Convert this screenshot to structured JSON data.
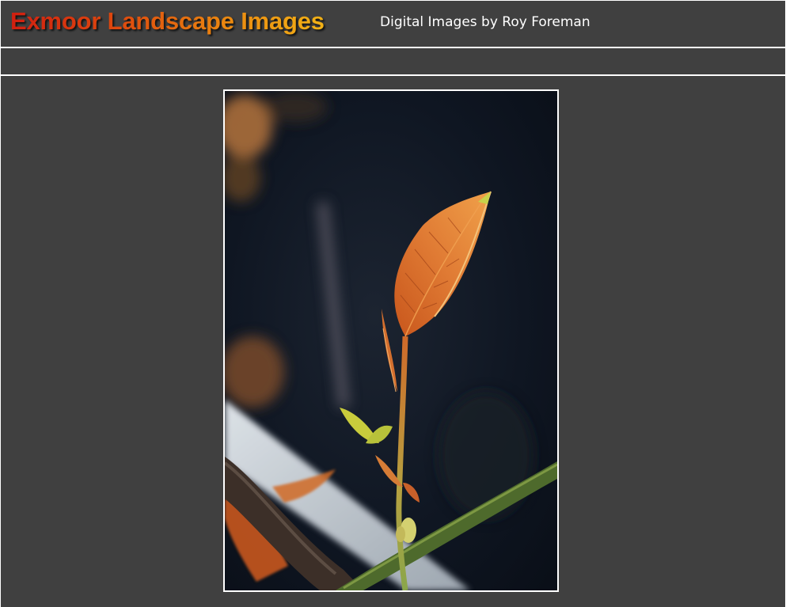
{
  "header": {
    "site_title": "Exmoor Landscape Images",
    "site_subtitle": "Digital Images by Roy Foreman"
  },
  "nav": {
    "items": []
  },
  "photo": {
    "subject": "rose-shoot-photo"
  },
  "colors": {
    "background": "#404040",
    "border": "#ffffff",
    "title_gradient_start": "#d01f10",
    "title_gradient_end": "#f2b216",
    "subtitle": "#ffffff"
  }
}
